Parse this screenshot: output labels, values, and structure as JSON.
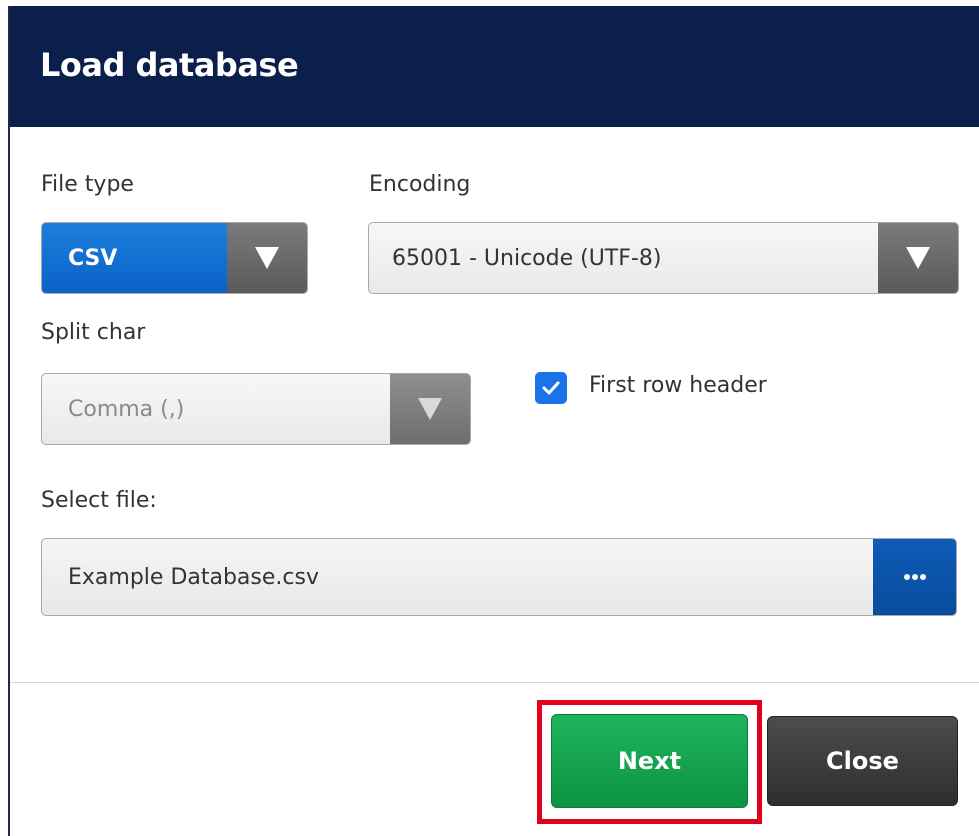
{
  "dialog": {
    "title": "Load database"
  },
  "file_type": {
    "label": "File type",
    "selected": "CSV"
  },
  "encoding": {
    "label": "Encoding",
    "selected": "65001 - Unicode (UTF-8)"
  },
  "split_char": {
    "label": "Split char",
    "selected": "Comma (,)",
    "enabled": false
  },
  "first_row_header": {
    "label": "First row header",
    "checked": true
  },
  "select_file": {
    "label": "Select file:",
    "value": "Example Database.csv",
    "browse_label": "•••"
  },
  "buttons": {
    "next": "Next",
    "close": "Close"
  },
  "colors": {
    "header_bg": "#0b1f4d",
    "accent_blue": "#0a62c7",
    "next_green": "#0d9444",
    "close_dark": "#2e2e2e",
    "highlight_red": "#e3001b"
  },
  "icons": {
    "dropdown": "chevron-down-icon",
    "checkbox": "check-icon",
    "browse": "more-horizontal-icon"
  }
}
